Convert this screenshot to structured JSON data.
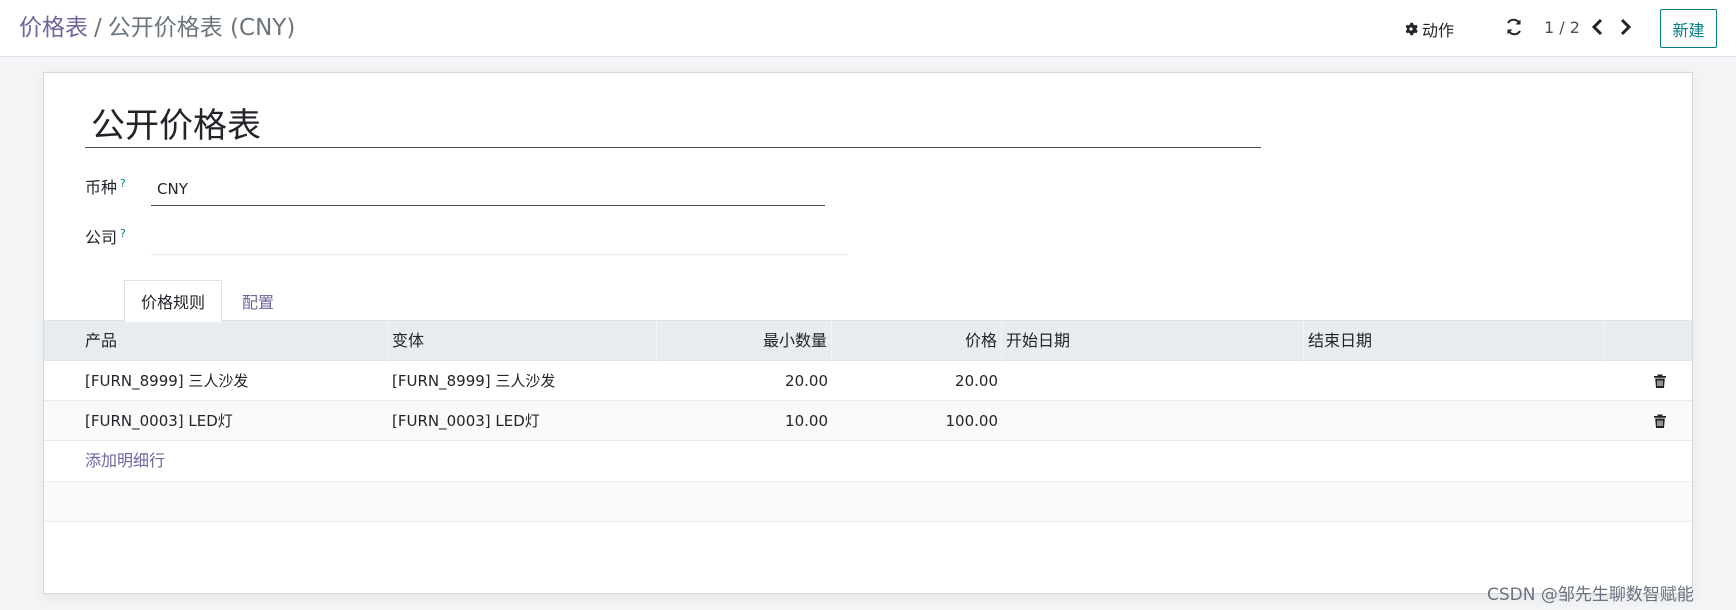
{
  "breadcrumb": {
    "parent": "价格表",
    "separator": "/",
    "current": "公开价格表 (CNY)"
  },
  "toolbar": {
    "actions_label": "动作",
    "pager_value": "1 / 2",
    "new_label": "新建"
  },
  "icons": {
    "actions": "gear-icon",
    "refresh": "refresh-icon",
    "prev": "chevron-left-icon",
    "next": "chevron-right-icon",
    "delete": "trash-icon"
  },
  "form": {
    "name": "公开价格表",
    "currency_label": "币种",
    "currency_help": "?",
    "currency_value": "CNY",
    "company_label": "公司",
    "company_help": "?",
    "company_value": ""
  },
  "tabs": [
    {
      "label": "价格规则",
      "active": true
    },
    {
      "label": "配置",
      "active": false
    }
  ],
  "table": {
    "columns": [
      "产品",
      "变体",
      "最小数量",
      "价格",
      "开始日期",
      "结束日期"
    ],
    "rows": [
      {
        "product": "[FURN_8999] 三人沙发",
        "variant": "[FURN_8999] 三人沙发",
        "min_qty": "20.00",
        "price": "20.00",
        "start": "",
        "end": ""
      },
      {
        "product": "[FURN_0003] LED灯",
        "variant": "[FURN_0003] LED灯",
        "min_qty": "10.00",
        "price": "100.00",
        "start": "",
        "end": ""
      }
    ],
    "add_line_label": "添加明细行"
  },
  "watermark": "CSDN @邹先生聊数智赋能",
  "colors": {
    "link": "#71639e",
    "primary": "#017e84",
    "header_bg": "#e9ecef"
  }
}
